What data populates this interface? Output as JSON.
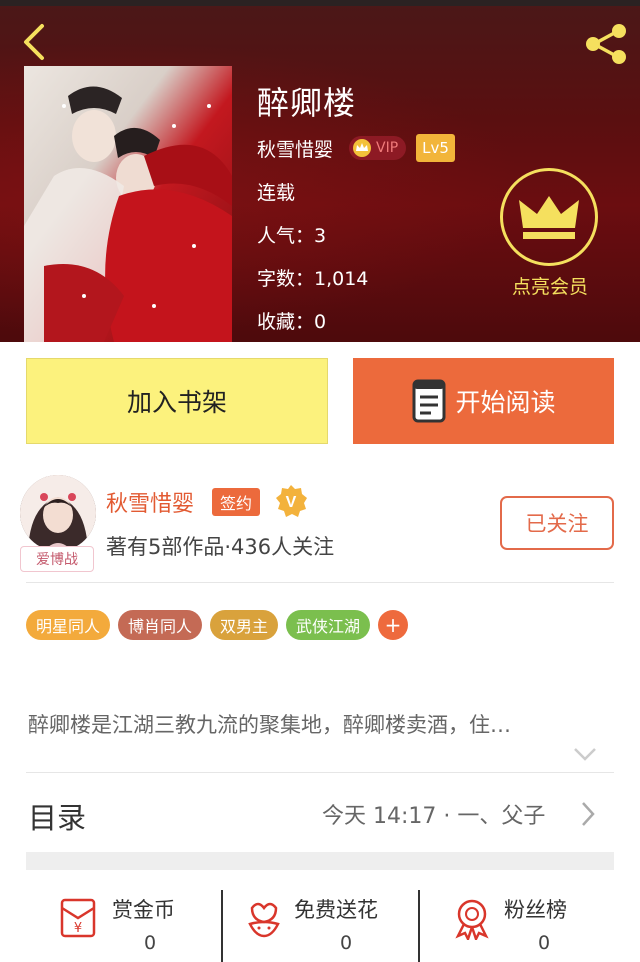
{
  "nav": {
    "back_icon": "chevron-left-icon",
    "share_icon": "share-icon"
  },
  "book": {
    "title": "醉卿楼",
    "author": "秋雪惜婴",
    "vip_text": "VIP",
    "level": "Lv5",
    "status": "连载",
    "popularity": "人气：3",
    "word_count": "字数：1,014",
    "favorites": "收藏：0"
  },
  "member": {
    "label": "点亮会员",
    "icon": "crown-icon"
  },
  "actions": {
    "shelf_label": "加入书架",
    "read_label": "开始阅读"
  },
  "author_card": {
    "name": "秋雪惜婴",
    "avatar_tag": "爱博战",
    "signed_label": "签约",
    "verified_text": "V",
    "stats": "著有5部作品·436人关注",
    "follow_label": "已关注"
  },
  "tags": [
    {
      "label": "明星同人",
      "color": "#f3aa3c"
    },
    {
      "label": "博肖同人",
      "color": "#c46a55"
    },
    {
      "label": "双男主",
      "color": "#d9a23c"
    },
    {
      "label": "武侠江湖",
      "color": "#7bbf4e"
    }
  ],
  "intro": "醉卿楼是江湖三教九流的聚集地，醉卿楼卖酒，住…",
  "catalog": {
    "label": "目录",
    "latest": "今天 14:17 · 一、父子"
  },
  "stats": {
    "reward": {
      "label": "赏金币",
      "count": "0"
    },
    "flowers": {
      "label": "免费送花",
      "count": "0"
    },
    "fans": {
      "label": "粉丝榜",
      "count": "0"
    }
  },
  "colors": {
    "accent": "#ec6a3c",
    "gold": "#f5e05e",
    "shelf_yellow": "#fcf27d"
  }
}
